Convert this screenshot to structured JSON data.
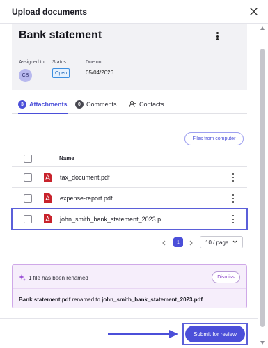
{
  "dialog": {
    "title": "Upload documents"
  },
  "document": {
    "title": "Bank statement",
    "labels": {
      "assigned": "Assigned to",
      "status": "Status",
      "due": "Due on"
    },
    "assignee_initials": "CB",
    "status": "Open",
    "due_date": "05/04/2026"
  },
  "tabs": [
    {
      "count": "3",
      "label": "Attachments",
      "active": true
    },
    {
      "count": "0",
      "label": "Comments",
      "active": false
    },
    {
      "label": "Contacts",
      "icon": "contact-icon",
      "active": false
    }
  ],
  "files_button": "Files from computer",
  "table": {
    "header_name": "Name",
    "rows": [
      {
        "name": "tax_document.pdf"
      },
      {
        "name": "expense-report.pdf"
      },
      {
        "name": "john_smith_bank_statement_2023.p..."
      }
    ]
  },
  "pagination": {
    "current_page": "1",
    "per_page": "10 / page"
  },
  "notice": {
    "message": "1 file has been renamed",
    "dismiss": "Dismiss",
    "old_name": "Bank statement.pdf",
    "renamed_to": " renamed to ",
    "new_name": "john_smith_bank_statement_2023.pdf"
  },
  "submit_label": "Submit for review",
  "colors": {
    "accent": "#4b4fd9",
    "notice_bg": "#f6eefb",
    "pdf_red": "#c8232c"
  }
}
